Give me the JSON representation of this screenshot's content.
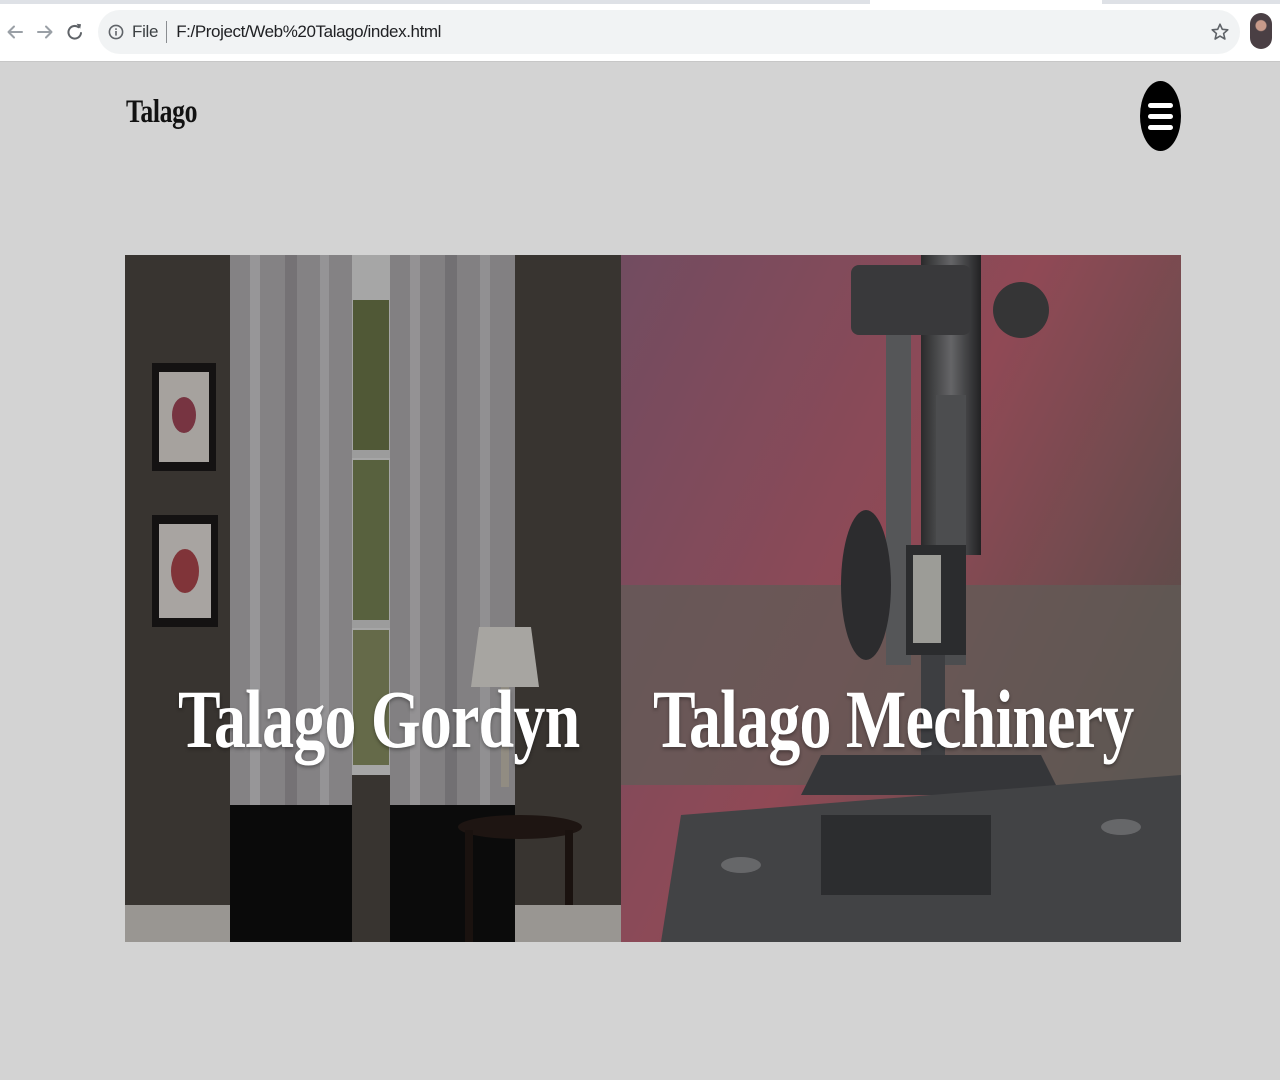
{
  "browser": {
    "scheme_label": "File",
    "url": "F:/Project/Web%20Talago/index.html",
    "icons": [
      "back-arrow-icon",
      "forward-arrow-icon",
      "reload-icon",
      "info-icon",
      "star-icon",
      "profile-avatar"
    ]
  },
  "header": {
    "brand": "Talago",
    "menu_icon": "hamburger-icon"
  },
  "panels": [
    {
      "title": "Talago Gordyn",
      "image": "curtains-room-photo"
    },
    {
      "title": "Talago Mechinery",
      "image": "sewing-machine-photo"
    }
  ],
  "colors": {
    "page_background": "#d3d3d3",
    "menu_button": "#000000",
    "title_text": "#ffffff"
  }
}
